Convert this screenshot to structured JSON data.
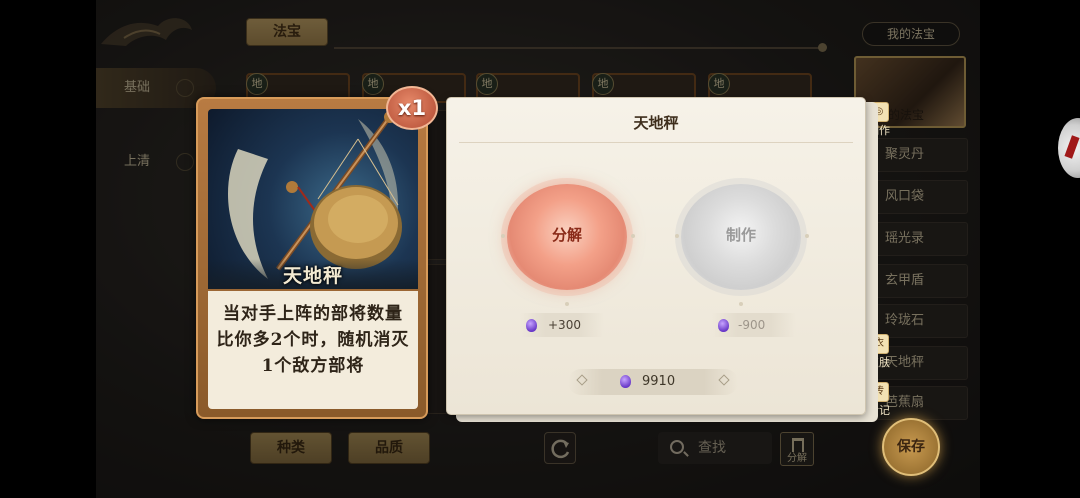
{
  "top_tab": {
    "label": "法宝"
  },
  "left_nav": [
    {
      "label": "基础"
    },
    {
      "label": "上清"
    }
  ],
  "grid_badges": [
    "地",
    "地",
    "地",
    "地",
    "地"
  ],
  "bottom_bar": {
    "filter_type": "种类",
    "filter_quality": "品质",
    "search_placeholder": "查找",
    "decompose_label": "分解"
  },
  "right_panel": {
    "header": "我的法宝",
    "card_label": "我的法宝",
    "items": [
      "聚灵丹",
      "风口袋",
      "瑶光录",
      "玄甲盾",
      "玲珑石",
      "天地秤",
      "芭蕉扇"
    ],
    "save_label": "保存"
  },
  "side_actions": {
    "make": "制作",
    "skin": "皮肤",
    "skin_icon": "衣",
    "bio": "传记",
    "bio_icon": "传"
  },
  "card": {
    "name": "天地秤",
    "count": "x1",
    "description": "当对手上阵的部将数量比你多2个时，随机消灭1个敌方部将"
  },
  "popup": {
    "title": "天地秤",
    "decompose_label": "分解",
    "craft_label": "制作",
    "decompose_gain": "+300",
    "craft_cost": "-900",
    "currency_total": "9910"
  },
  "colors": {
    "accent_gold": "#c9a96b",
    "card_frame": "#b87b42",
    "decompose_red": "#e58a74",
    "gem_purple": "#6a3ac8"
  }
}
